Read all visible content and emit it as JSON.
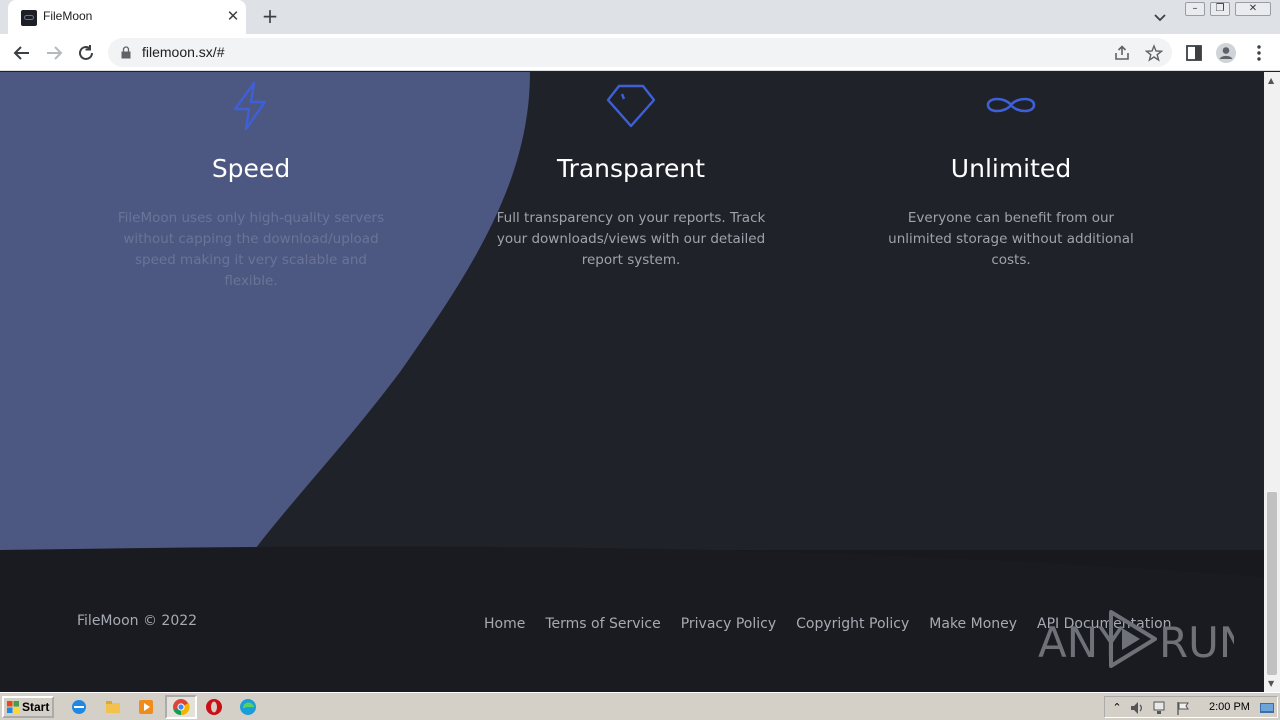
{
  "browser": {
    "tab_title": "FileMoon",
    "url": "filemoon.sx/#"
  },
  "features": [
    {
      "icon": "lightning-icon",
      "title": "Speed",
      "description": "FileMoon uses only high-quality servers without capping the download/upload speed making it very scalable and flexible."
    },
    {
      "icon": "diamond-icon",
      "title": "Transparent",
      "description": "Full transparency on your reports. Track your downloads/views with our detailed report system."
    },
    {
      "icon": "infinity-icon",
      "title": "Unlimited",
      "description": "Everyone can benefit from our unlimited storage without additional costs."
    }
  ],
  "footer": {
    "copyright": "FileMoon © 2022",
    "links": [
      "Home",
      "Terms of Service",
      "Privacy Policy",
      "Copyright Policy",
      "Make Money",
      "API Documentation"
    ]
  },
  "watermark": {
    "text_left": "ANY",
    "text_right": "RUN"
  },
  "taskbar": {
    "start_label": "Start",
    "clock": "2:00 PM"
  },
  "colors": {
    "accent": "#3f5fd6",
    "page_bg": "#1f2229",
    "curve_bg": "#4d5882",
    "footer_bg": "#17191e"
  }
}
